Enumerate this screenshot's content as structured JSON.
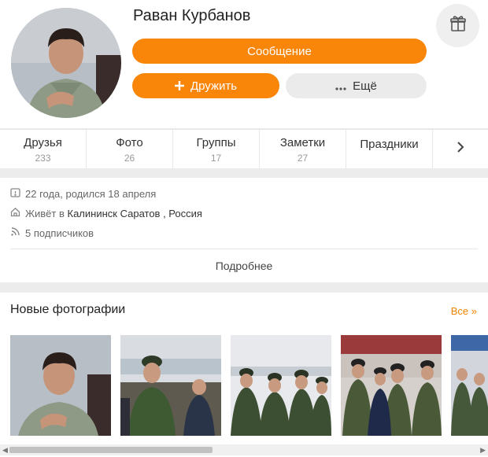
{
  "profile": {
    "name": "Раван Курбанов",
    "message_label": "Сообщение",
    "friend_label": "Дружить",
    "more_label": "Ещё"
  },
  "tabs": [
    {
      "label": "Друзья",
      "count": "233"
    },
    {
      "label": "Фото",
      "count": "26"
    },
    {
      "label": "Группы",
      "count": "17"
    },
    {
      "label": "Заметки",
      "count": "27"
    },
    {
      "label": "Праздники",
      "count": ""
    }
  ],
  "info": {
    "age_text": "22 года, родился 18 апреля",
    "lives_prefix": "Живёт в",
    "lives_place": "Калининск Саратов , Россия",
    "subscribers": "5 подписчиков",
    "details_link": "Подробнее"
  },
  "photos": {
    "title": "Новые фотографии",
    "all_link": "Все »"
  },
  "icons": {
    "gift": "gift-icon",
    "plus": "plus-icon",
    "dots": "dots-icon",
    "tabs_next": "chevron-right-icon",
    "age": "calendar-icon",
    "home": "home-icon",
    "feed": "rss-icon"
  },
  "colors": {
    "accent": "#f98509",
    "link": "#f08200"
  }
}
